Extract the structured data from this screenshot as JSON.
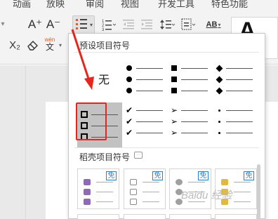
{
  "menu": {
    "tabs": [
      "动画",
      "放映",
      "审阅",
      "视图",
      "开发工具",
      "特色功能"
    ]
  },
  "ribbon": {
    "grow_font": "A⁺",
    "shrink_font": "A⁻",
    "subscript": "X₂",
    "eraser_label": "eraser",
    "pinyin": "wén",
    "pinyin_char": "文",
    "text_dir": "AB",
    "big_a": "A"
  },
  "panel": {
    "preset_title": "预设项目符号",
    "none_label": "无",
    "daoke_title": "稻壳项目符号",
    "badge": "免"
  },
  "watermark": "Baidu 经验",
  "colors": {
    "highlight": "#e8251c",
    "selected_cell": "#c2c2c2",
    "badge_blue": "#2d7fd4"
  }
}
